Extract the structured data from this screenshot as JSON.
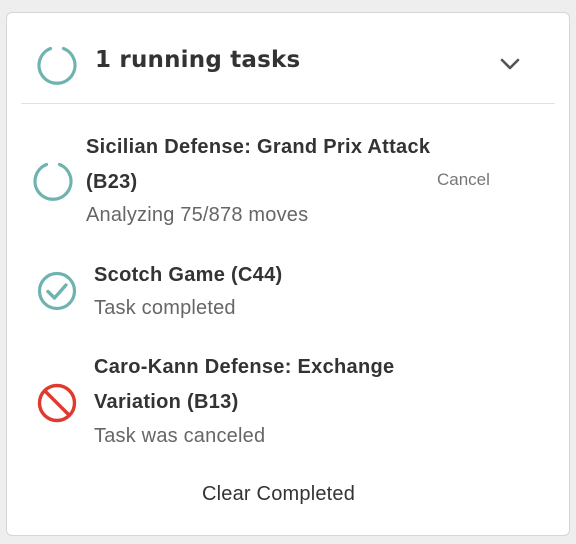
{
  "header": {
    "title": "1 running tasks",
    "spinner_icon": "spinner-icon",
    "toggle_icon": "chevron-down-icon"
  },
  "tasks": [
    {
      "title": "Sicilian Defense: Grand Prix Attack (B23)",
      "status": "Analyzing 75/878 moves",
      "state": "running",
      "icon": "spinner-icon",
      "action_label": "Cancel"
    },
    {
      "title": "Scotch Game (C44)",
      "status": "Task completed",
      "state": "completed",
      "icon": "check-circle-icon"
    },
    {
      "title": "Caro-Kann Defense: Exchange Variation (B13)",
      "status": "Task was canceled",
      "state": "canceled",
      "icon": "prohibited-icon"
    }
  ],
  "footer": {
    "clear_label": "Clear Completed"
  },
  "colors": {
    "accent_teal": "#6fb3b0",
    "cancel_red": "#e03a2f",
    "text_dark": "#333333",
    "text_muted": "#666666"
  }
}
